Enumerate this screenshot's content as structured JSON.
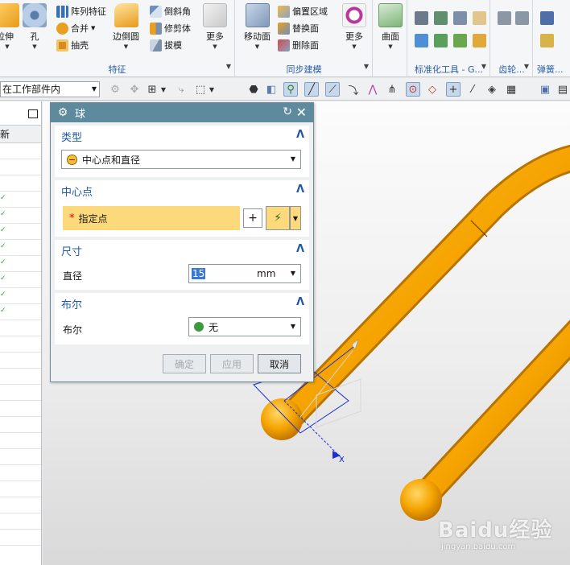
{
  "ribbon": {
    "groups": [
      {
        "label": "特征"
      },
      {
        "label": "同步建模"
      },
      {
        "label": "标准化工具 - G..."
      },
      {
        "label": "齿轮..."
      },
      {
        "label": "弹簧..."
      }
    ],
    "buttons": {
      "extrude": "拉伸",
      "hole": "孔",
      "pattern_feature": "阵列特征",
      "unite": "合并",
      "shell": "抽壳",
      "edge_blend": "边倒圆",
      "chamfer": "倒斜角",
      "trim_body": "修剪体",
      "draft": "拔模",
      "more1": "更多",
      "move_face": "移动面",
      "offset_region": "偏置区域",
      "replace_face": "替换面",
      "delete_face": "删除面",
      "more2": "更多",
      "surface": "曲面"
    }
  },
  "toolbar2": {
    "selection_filter": "在工作部件内"
  },
  "navigator": {
    "column_header": "最新"
  },
  "dialog": {
    "title": "球",
    "type_section": {
      "title": "类型",
      "value": "中心点和直径"
    },
    "center_section": {
      "title": "中心点",
      "specify_label": "指定点"
    },
    "dimension_section": {
      "title": "尺寸",
      "diameter_label": "直径",
      "diameter_value": "15",
      "unit": "mm"
    },
    "boolean_section": {
      "title": "布尔",
      "label": "布尔",
      "value": "无"
    },
    "buttons": {
      "ok": "确定",
      "apply": "应用",
      "cancel": "取消"
    }
  },
  "viewport": {
    "axis_label": "X"
  },
  "watermark": {
    "brand": "Baidu经验",
    "url": "jingyan.baidu.com"
  },
  "colors": {
    "tube": "#f5a300",
    "dialog_title": "#5e8a9e",
    "required_field": "#fcd97a",
    "section_title": "#1f5aa8"
  }
}
